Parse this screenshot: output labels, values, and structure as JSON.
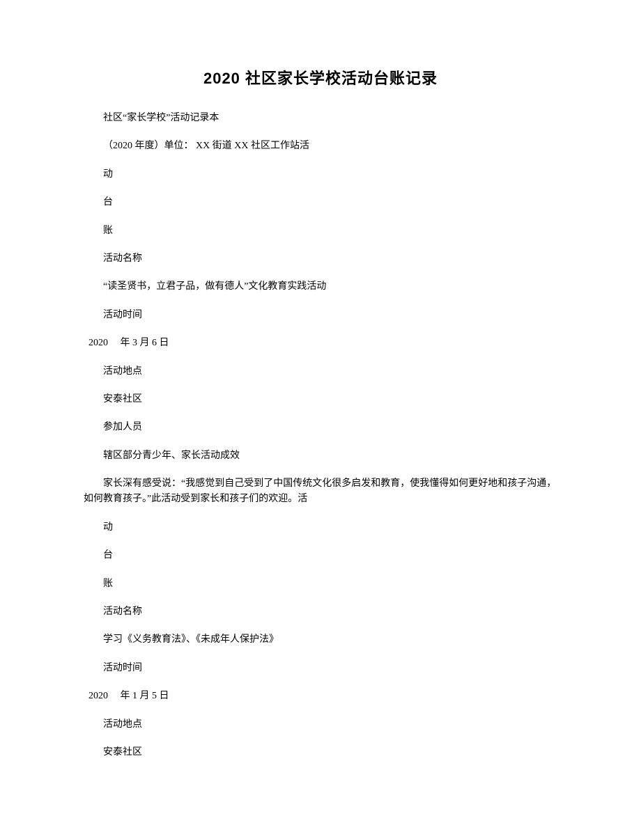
{
  "title": "2020 社区家长学校活动台账记录",
  "lines": {
    "l1": "社区“家长学校”活动记录本",
    "l2": "（2020 年度）单位： XX 街道 XX 社区工作站活",
    "l3": "动",
    "l4": "台",
    "l5": "账",
    "l6": "活动名称",
    "l7": "“读圣贤书，立君子品，做有德人”文化教育实践活动",
    "l8": "活动时间",
    "l9": "2020　 年 3 月 6 日",
    "l10": "活动地点",
    "l11": "安泰社区",
    "l12": "参加人员",
    "l13": "辖区部分青少年、家长活动成效",
    "l14": "家长深有感受说：“我感觉到自己受到了中国传统文化很多启发和教育，使我懂得如何更好地和孩子沟通，如何教育孩子。”此活动受到家长和孩子们的欢迎。活",
    "l15": "动",
    "l16": "台",
    "l17": "账",
    "l18": "活动名称",
    "l19": "学习《义务教育法》、《未成年人保护法》",
    "l20": "活动时间",
    "l21": "2020　 年 1 月 5 日",
    "l22": "活动地点",
    "l23": "安泰社区"
  }
}
